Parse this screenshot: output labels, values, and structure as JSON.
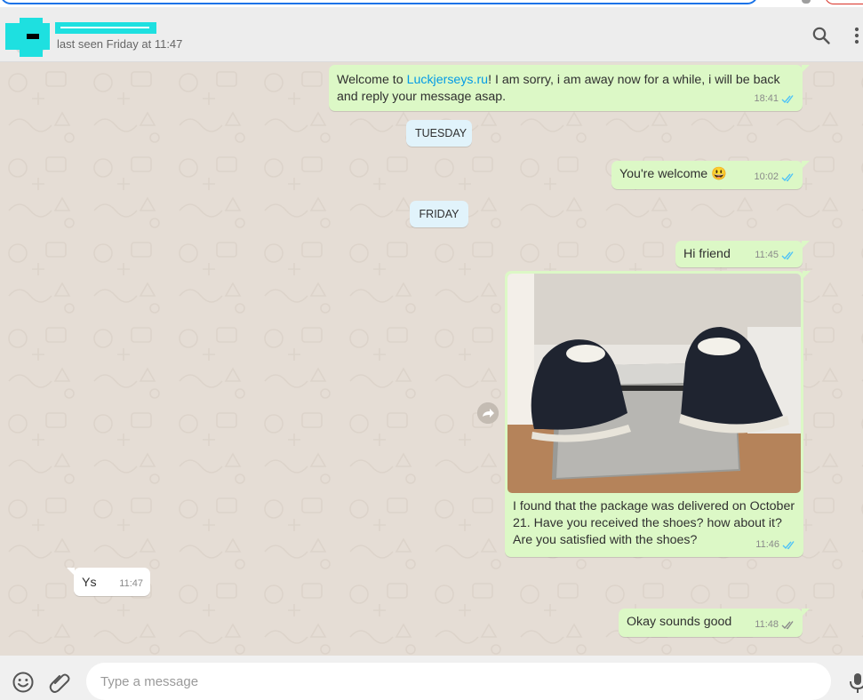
{
  "header": {
    "contact_status": "last seen Friday at 11:47"
  },
  "day_separators": [
    "TUESDAY",
    "FRIDAY"
  ],
  "messages": [
    {
      "direction": "out",
      "text_before": "Welcome to ",
      "link": "Luckjerseys.ru",
      "text_after": "! I am sorry, i am away now for a while, i will be back\nand reply your message asap.",
      "time": "18:41",
      "status": "read"
    },
    {
      "direction": "out",
      "text": "You're welcome",
      "emoji": "😃",
      "time": "10:02",
      "status": "read"
    },
    {
      "direction": "out",
      "text": "Hi friend",
      "time": "11:45",
      "status": "read"
    },
    {
      "direction": "out",
      "type": "image",
      "caption": "I found that the package was delivered on October\n21. Have you received the shoes? how about it?\nAre you satisfied with the shoes?",
      "time": "11:46",
      "status": "read"
    },
    {
      "direction": "in",
      "text": "Ys",
      "time": "11:47"
    },
    {
      "direction": "out",
      "text": "Okay sounds good",
      "time": "11:48",
      "status": "delivered"
    }
  ],
  "composer": {
    "placeholder": "Type a message"
  },
  "colors": {
    "outgoing_bubble": "#dcf8c6",
    "incoming_bubble": "#ffffff",
    "day_chip": "#e1f3fb",
    "chat_background": "#e5ddd5",
    "read_tick": "#4fc3f7",
    "link": "#039be5"
  },
  "icons": [
    "search-icon",
    "menu-dots-icon",
    "emoji-icon",
    "attach-icon",
    "mic-icon",
    "forward-icon",
    "double-tick-icon"
  ]
}
